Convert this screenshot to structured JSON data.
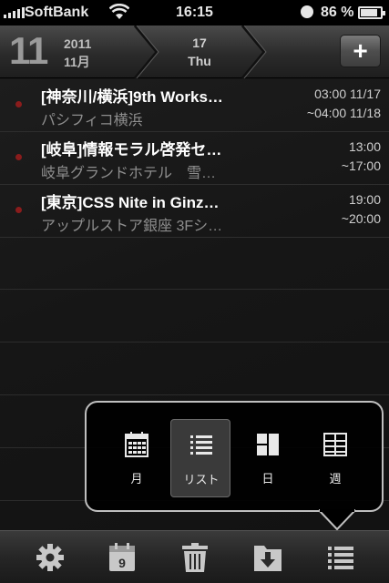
{
  "status_bar": {
    "carrier": "SoftBank",
    "time": "16:15",
    "battery": "86 %"
  },
  "header": {
    "day": "11",
    "year": "2011",
    "month": "11月",
    "date_day": "17",
    "date_weekday": "Thu",
    "add_label": "+"
  },
  "events": [
    {
      "title": "[神奈川/横浜]9th Works…",
      "place": "パシフィコ横浜",
      "start": "03:00 11/17",
      "end": "~04:00 11/18"
    },
    {
      "title": "[岐阜]情報モラル啓発セ…",
      "place": "岐阜グランドホテル　雪…",
      "start": "13:00",
      "end": "~17:00"
    },
    {
      "title": "[東京]CSS Nite in Ginz…",
      "place": "アップルストア銀座 3Fシ…",
      "start": "19:00",
      "end": "~20:00"
    }
  ],
  "view_menu": {
    "options": [
      {
        "label": "月",
        "icon": "calendar-month-icon"
      },
      {
        "label": "リスト",
        "icon": "list-icon",
        "selected": true
      },
      {
        "label": "日",
        "icon": "day-view-icon"
      },
      {
        "label": "週",
        "icon": "week-view-icon"
      }
    ]
  },
  "toolbar": {
    "calendar_number": "9",
    "icons": [
      "gear-icon",
      "calendar-icon",
      "trash-icon",
      "download-icon",
      "list-icon"
    ]
  },
  "colors": {
    "event_dot": "#8a1c1c",
    "background": "#171717"
  }
}
